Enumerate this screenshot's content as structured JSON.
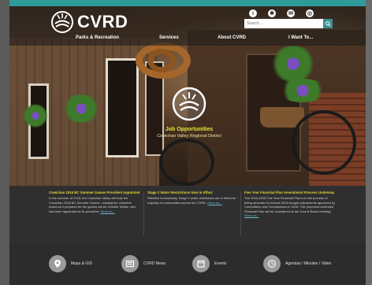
{
  "brand": {
    "name": "CVRD"
  },
  "header": {
    "utility_icons": [
      "info-icon",
      "settings-icon",
      "share-icon",
      "accessibility-icon"
    ],
    "search_placeholder": "Search..."
  },
  "nav": {
    "items": [
      {
        "label": "Parks & Recreation"
      },
      {
        "label": "Services"
      },
      {
        "label": "About CVRD"
      },
      {
        "label": "I Want To..."
      }
    ]
  },
  "promo": {
    "title": "Job Opportunities",
    "subtitle": "Cowichan Valley Regional District"
  },
  "news": [
    {
      "title": "Cowichan 2018 BC Summer Games President Appointed",
      "body": "In the summer of 2018, the Cowichan Valley will host the Cowichan 2018 BC Summer Games. Leading the volunteer board as it prepares for the games will be Jennifer Woike, who has been appointed as its president.",
      "link": "Read on..."
    },
    {
      "title": "Stage 2 Water Restrictions Now in Effect",
      "body": "Effective immediately, Stage 2 water restrictions are in effect for majority of communities across the CVRD.",
      "link": "Read on..."
    },
    {
      "title": "Five Year Financial Plan Amendment Process Underway",
      "body": "The 2016-2020 Five Year Financial Plan is in the process of being amended to include 2015 budget adjustments approved by Committees and Commissions in 2016. The proposed amended Financial Plan will be considered at the June 8 Board meeting.",
      "link": "Read on..."
    }
  ],
  "footer": {
    "items": [
      {
        "label": "Maps & GIS",
        "icon": "map-pin-icon"
      },
      {
        "label": "CVRD News",
        "icon": "news-icon"
      },
      {
        "label": "Events",
        "icon": "calendar-icon"
      },
      {
        "label": "Agendas / Minutes / Video",
        "icon": "clock-icon"
      }
    ]
  },
  "colors": {
    "accent": "#2e9a9a",
    "headline": "#e2d83a",
    "link": "#6fb7d0",
    "background": "#2b2b2b"
  }
}
